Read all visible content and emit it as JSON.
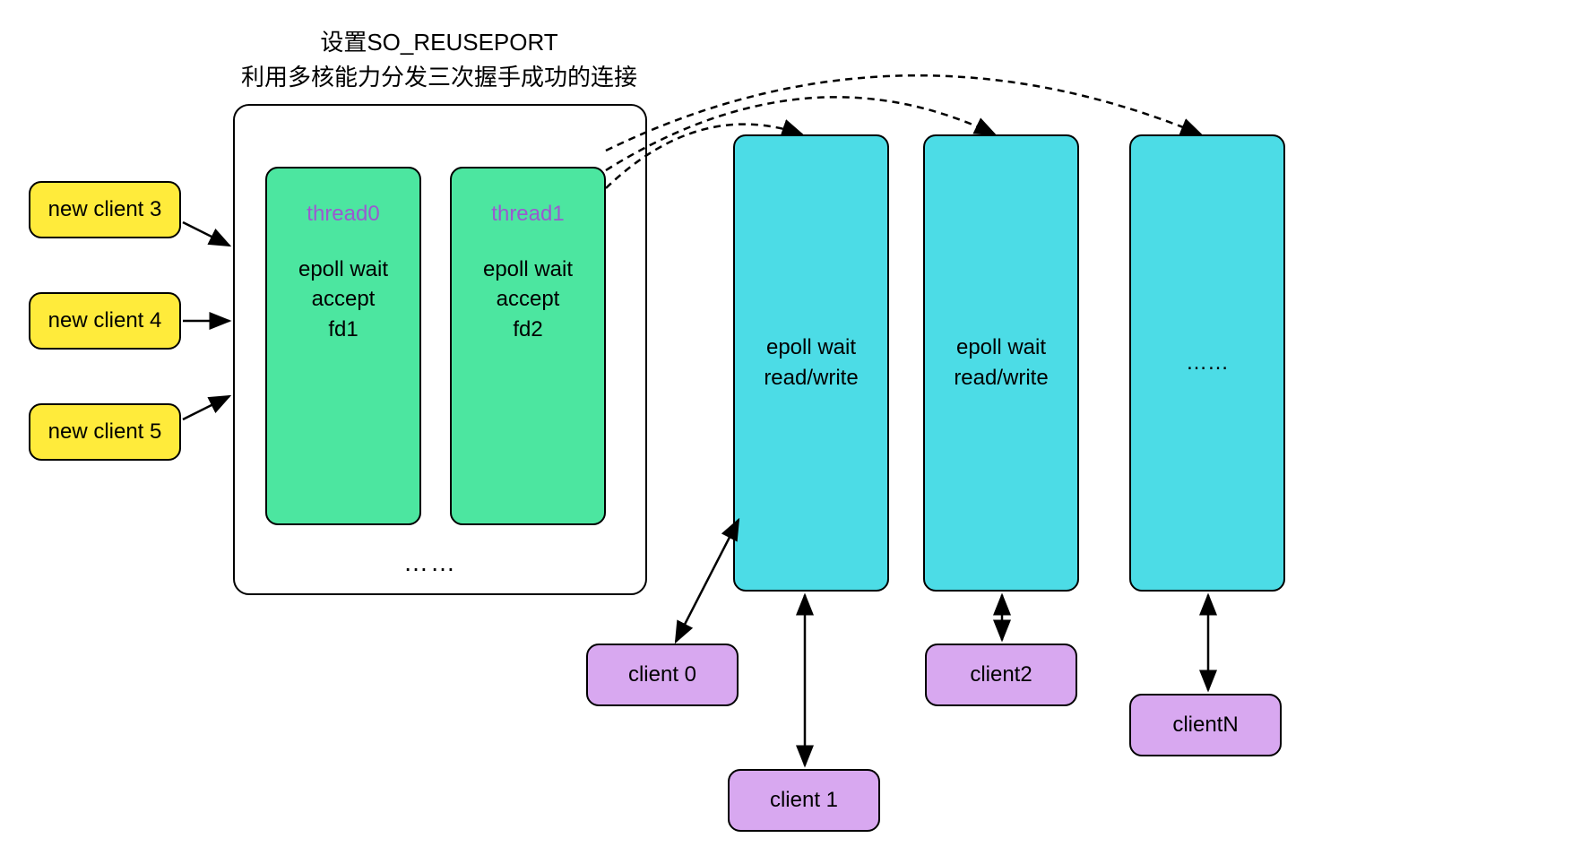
{
  "title": {
    "line1": "设置SO_REUSEPORT",
    "line2": "利用多核能力分发三次握手成功的连接"
  },
  "new_clients": [
    {
      "label": "new client 3"
    },
    {
      "label": "new client 4"
    },
    {
      "label": "new client 5"
    }
  ],
  "accept_threads": [
    {
      "name": "thread0",
      "line1": "epoll wait",
      "line2": "accept",
      "line3": "fd1"
    },
    {
      "name": "thread1",
      "line1": "epoll wait",
      "line2": "accept",
      "line3": "fd2"
    }
  ],
  "accept_ellipsis": "……",
  "worker_threads": [
    {
      "line1": "epoll wait",
      "line2": "read/write"
    },
    {
      "line1": "epoll wait",
      "line2": "read/write"
    },
    {
      "label": "……"
    }
  ],
  "clients": [
    {
      "label": "client 0"
    },
    {
      "label": "client 1"
    },
    {
      "label": "client2"
    },
    {
      "label": "clientN"
    }
  ],
  "colors": {
    "yellow": "#FFEB3B",
    "green": "#4CE6A0",
    "cyan": "#4CDCE6",
    "violet": "#D8A8F0"
  }
}
